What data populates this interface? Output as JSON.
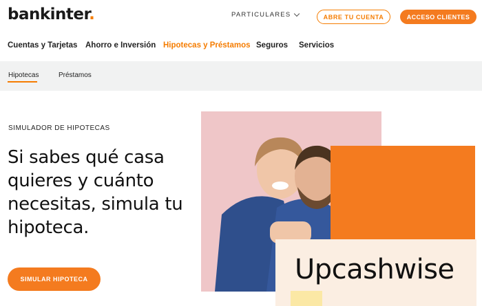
{
  "header": {
    "logo": "bankinter",
    "logo_dot": ".",
    "segment": "PARTICULARES",
    "open_account": "ABRE TU CUENTA",
    "client_access": "ACCESO CLIENTES"
  },
  "nav": {
    "items": [
      "Cuentas y Tarjetas",
      "Ahorro e Inversión",
      "Hipotecas y Préstamos",
      "Seguros",
      "Servicios"
    ],
    "active": "Hipotecas y Préstamos"
  },
  "subnav": {
    "items": [
      "Hipotecas",
      "Préstamos"
    ],
    "active": "Hipotecas"
  },
  "hero": {
    "eyebrow": "SIMULADOR DE HIPOTECAS",
    "headline": "Si sabes qué casa quieres y cuánto necesitas, simula tu hipoteca.",
    "cta": "SIMULAR HIPOTECA"
  },
  "watermark": "Upcashwise",
  "colors": {
    "brand": "#f57c00",
    "subnav_bg": "#f1f2f2",
    "photo_bg": "#efc6c8"
  }
}
